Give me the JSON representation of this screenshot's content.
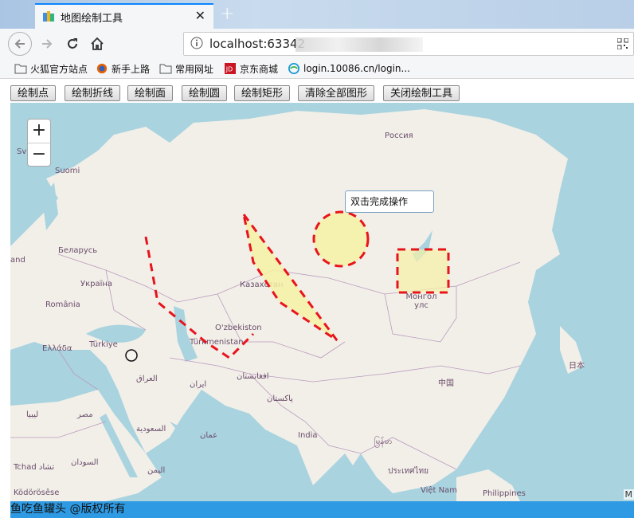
{
  "browser": {
    "tab_title": "地图绘制工具",
    "url": "localhost:63342",
    "bookmarks": [
      "火狐官方站点",
      "新手上路",
      "常用网址",
      "京东商城",
      "login.10086.cn/login..."
    ]
  },
  "toolbar": {
    "buttons": [
      "绘制点",
      "绘制折线",
      "绘制面",
      "绘制圆",
      "绘制矩形",
      "清除全部图形",
      "关闭绘制工具"
    ]
  },
  "map": {
    "zoom_in": "+",
    "zoom_out": "−",
    "tooltip": "双击完成操作",
    "attribution": "M",
    "labels": [
      "Россия",
      "Suomi",
      "Sv",
      "Беларусь",
      "and",
      "Україна",
      "România",
      "Ελλάδα",
      "Türkiye",
      "Казахстан",
      "O'zbekiston",
      "Türkmenistan",
      "Монгол улс",
      "中国",
      "日本",
      "العراق",
      "ایران",
      "افغانستان",
      "پاکستان",
      "India",
      "السعودية",
      "مصر",
      "ليبيا",
      "السودان",
      "Tchad تشاد",
      "اليمن",
      "عمان",
      "မြန်မာ",
      "ประเทศไทย",
      "Việt Nam",
      "Philippines",
      "Ködörösêse"
    ],
    "colors": {
      "water": "#a9d3df",
      "land": "#f2efe9",
      "stroke": "#e8141c",
      "fill": "#f6f1a4"
    }
  },
  "footer": {
    "text": "鱼吃鱼罐头 @版权所有"
  }
}
